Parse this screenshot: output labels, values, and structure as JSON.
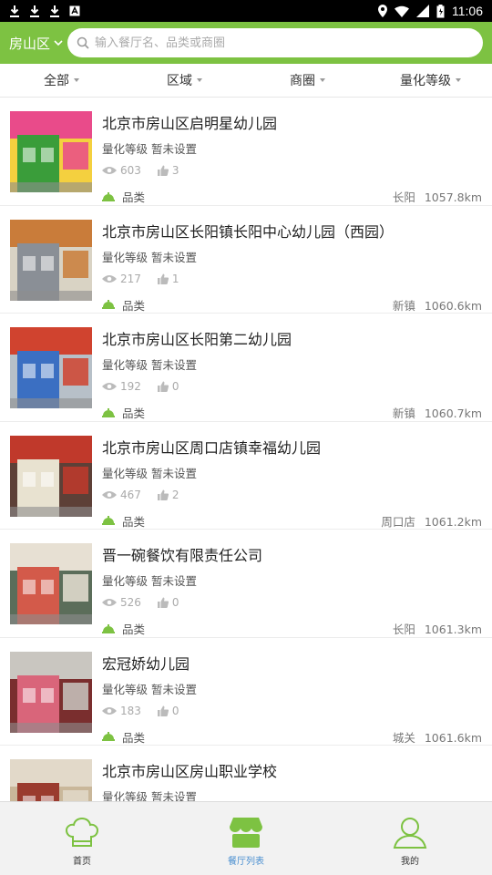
{
  "status_bar": {
    "time": "11:06"
  },
  "header": {
    "district": "房山区",
    "search_placeholder": "输入餐厅名、品类或商圈"
  },
  "filters": [
    {
      "label": "全部"
    },
    {
      "label": "区域"
    },
    {
      "label": "商圈"
    },
    {
      "label": "量化等级"
    }
  ],
  "restaurants": [
    {
      "name": "北京市房山区启明星幼儿园",
      "grade_label": "量化等级",
      "grade_value": "暂未设置",
      "views": "603",
      "likes": "3",
      "category": "品类",
      "area": "长阳",
      "distance": "1057.8km",
      "thumb_colors": [
        "#3a9d3a",
        "#e94b8a",
        "#f4d03f"
      ]
    },
    {
      "name": "北京市房山区长阳镇长阳中心幼儿园（西园）",
      "grade_label": "量化等级",
      "grade_value": "暂未设置",
      "views": "217",
      "likes": "1",
      "category": "品类",
      "area": "新镇",
      "distance": "1060.6km",
      "thumb_colors": [
        "#8a8f96",
        "#c97c3a",
        "#d9d3c4"
      ]
    },
    {
      "name": "北京市房山区长阳第二幼儿园",
      "grade_label": "量化等级",
      "grade_value": "暂未设置",
      "views": "192",
      "likes": "0",
      "category": "品类",
      "area": "新镇",
      "distance": "1060.7km",
      "thumb_colors": [
        "#3b6fc2",
        "#d0432f",
        "#b7c0c8"
      ]
    },
    {
      "name": "北京市房山区周口店镇幸福幼儿园",
      "grade_label": "量化等级",
      "grade_value": "暂未设置",
      "views": "467",
      "likes": "2",
      "category": "品类",
      "area": "周口店",
      "distance": "1061.2km",
      "thumb_colors": [
        "#e8e2d0",
        "#c0392b",
        "#5d4037"
      ]
    },
    {
      "name": "晋一碗餐饮有限责任公司",
      "grade_label": "量化等级",
      "grade_value": "暂未设置",
      "views": "526",
      "likes": "0",
      "category": "品类",
      "area": "长阳",
      "distance": "1061.3km",
      "thumb_colors": [
        "#d35a4a",
        "#e7e0d3",
        "#5b6d5a"
      ]
    },
    {
      "name": "宏冠娇幼儿园",
      "grade_label": "量化等级",
      "grade_value": "暂未设置",
      "views": "183",
      "likes": "0",
      "category": "品类",
      "area": "城关",
      "distance": "1061.6km",
      "thumb_colors": [
        "#d9657a",
        "#c9c6c0",
        "#7a2e2e"
      ]
    },
    {
      "name": "北京市房山区房山职业学校",
      "grade_label": "量化等级",
      "grade_value": "暂未设置",
      "views": "",
      "likes": "",
      "category": "",
      "area": "",
      "distance": "",
      "thumb_colors": [
        "#9a3b2e",
        "#e2d9c9",
        "#c9b79a"
      ]
    }
  ],
  "tabbar": [
    {
      "label": "首页",
      "icon": "chef-hat-icon",
      "active": false
    },
    {
      "label": "餐厅列表",
      "icon": "restaurant-list-icon",
      "active": true
    },
    {
      "label": "我的",
      "icon": "user-icon",
      "active": false
    }
  ],
  "colors": {
    "brand_green": "#7dc242",
    "active_blue": "#4a8fd0"
  }
}
